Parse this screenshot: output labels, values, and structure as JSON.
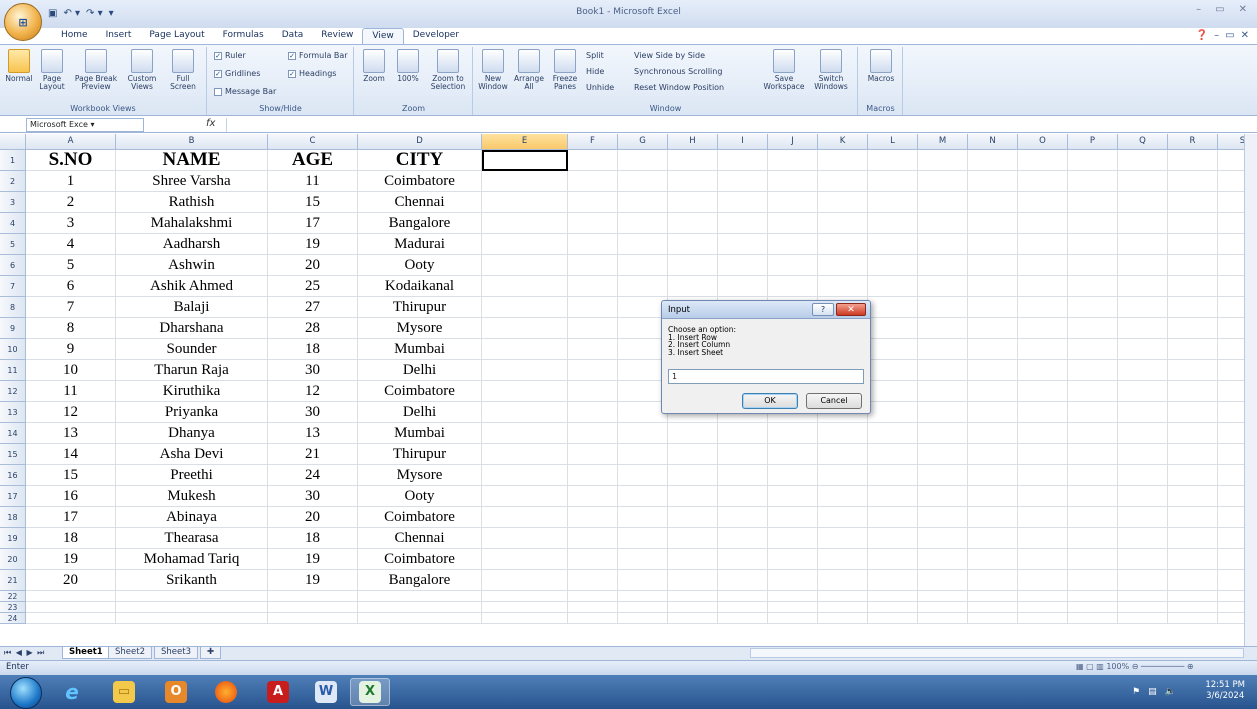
{
  "window": {
    "title": "Book1 - Microsoft Excel",
    "office_button_label": "Office",
    "minimize": "–",
    "restore": "▭",
    "close": "✕"
  },
  "ribbon": {
    "tabs": [
      "Home",
      "Insert",
      "Page Layout",
      "Formulas",
      "Data",
      "Review",
      "View",
      "Developer"
    ],
    "active_tab": "View",
    "groups": {
      "workbook_views": {
        "label": "Workbook Views",
        "buttons": [
          "Normal",
          "Page Layout",
          "Page Break Preview",
          "Custom Views",
          "Full Screen"
        ]
      },
      "show_hide": {
        "label": "Show/Hide",
        "checks": [
          "Ruler",
          "Formula Bar",
          "Gridlines",
          "Headings",
          "Message Bar"
        ]
      },
      "zoom": {
        "label": "Zoom",
        "buttons": [
          "Zoom",
          "100%",
          "Zoom to Selection"
        ]
      },
      "window": {
        "label": "Window",
        "buttons": [
          "New Window",
          "Arrange All",
          "Freeze Panes"
        ],
        "small": [
          "Split",
          "Hide",
          "Unhide",
          "View Side by Side",
          "Synchronous Scrolling",
          "Reset Window Position"
        ],
        "save_workspace": "Save Workspace",
        "switch_windows": "Switch Windows"
      },
      "macros": {
        "label": "Macros",
        "button": "Macros"
      }
    }
  },
  "formula_bar": {
    "name_box": "Microsoft Exce",
    "fx": "fx",
    "value": ""
  },
  "grid": {
    "columns": [
      "A",
      "B",
      "C",
      "D",
      "E",
      "F",
      "G",
      "H",
      "I",
      "J",
      "K",
      "L",
      "M",
      "N",
      "O",
      "P",
      "Q",
      "R",
      "S"
    ],
    "selected_column": "E",
    "header": [
      "S.NO",
      "NAME",
      "AGE",
      "CITY"
    ],
    "rows": [
      [
        "1",
        "Shree Varsha",
        "11",
        "Coimbatore"
      ],
      [
        "2",
        "Rathish",
        "15",
        "Chennai"
      ],
      [
        "3",
        "Mahalakshmi",
        "17",
        "Bangalore"
      ],
      [
        "4",
        "Aadharsh",
        "19",
        "Madurai"
      ],
      [
        "5",
        "Ashwin",
        "20",
        "Ooty"
      ],
      [
        "6",
        "Ashik Ahmed",
        "25",
        "Kodaikanal"
      ],
      [
        "7",
        "Balaji",
        "27",
        "Thirupur"
      ],
      [
        "8",
        "Dharshana",
        "28",
        "Mysore"
      ],
      [
        "9",
        "Sounder",
        "18",
        "Mumbai"
      ],
      [
        "10",
        "Tharun Raja",
        "30",
        "Delhi"
      ],
      [
        "11",
        "Kiruthika",
        "12",
        "Coimbatore"
      ],
      [
        "12",
        "Priyanka",
        "30",
        "Delhi"
      ],
      [
        "13",
        "Dhanya",
        "13",
        "Mumbai"
      ],
      [
        "14",
        "Asha Devi",
        "21",
        "Thirupur"
      ],
      [
        "15",
        "Preethi",
        "24",
        "Mysore"
      ],
      [
        "16",
        "Mukesh",
        "30",
        "Ooty"
      ],
      [
        "17",
        "Abinaya",
        "20",
        "Coimbatore"
      ],
      [
        "18",
        "Thearasa",
        "18",
        "Chennai"
      ],
      [
        "19",
        "Mohamad Tariq",
        "19",
        "Coimbatore"
      ],
      [
        "20",
        "Srikanth",
        "19",
        "Bangalore"
      ]
    ],
    "row_numbers": [
      "1",
      "2",
      "3",
      "4",
      "5",
      "6",
      "7",
      "8",
      "9",
      "10",
      "11",
      "12",
      "13",
      "14",
      "15",
      "16",
      "17",
      "18",
      "19",
      "20",
      "21",
      "22",
      "23",
      "24"
    ]
  },
  "sheets": [
    "Sheet1",
    "Sheet2",
    "Sheet3"
  ],
  "active_sheet": "Sheet1",
  "status": {
    "mode": "Enter",
    "zoom": "100%"
  },
  "dialog": {
    "title": "Input",
    "help": "?",
    "close": "✕",
    "prompt": "Choose an option:\n1. Insert Row\n2. Insert Column\n3. Insert Sheet",
    "value": "1",
    "ok": "OK",
    "cancel": "Cancel"
  },
  "taskbar": {
    "apps": [
      "start-orb",
      "internet-explorer",
      "file-explorer",
      "outlook",
      "firefox",
      "adobe-reader",
      "word",
      "excel"
    ],
    "time": "12:51 PM",
    "date": "3/6/2024"
  }
}
